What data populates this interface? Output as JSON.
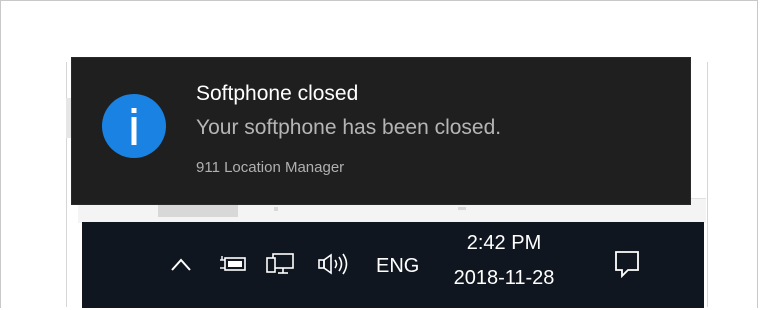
{
  "toast": {
    "title": "Softphone closed",
    "message": "Your softphone has been closed.",
    "app_name": "911 Location Manager",
    "icon": "info-icon",
    "accent_color": "#1a82e2",
    "background_color": "#1f1f1f"
  },
  "taskbar": {
    "background_color": "#10161f",
    "tray_icons": [
      "chevron-up-icon",
      "power-icon",
      "network-icon",
      "volume-icon"
    ],
    "language": "ENG",
    "clock": {
      "time": "2:42 PM",
      "date": "2018-11-28"
    },
    "action_center_icon": "action-center-icon"
  }
}
